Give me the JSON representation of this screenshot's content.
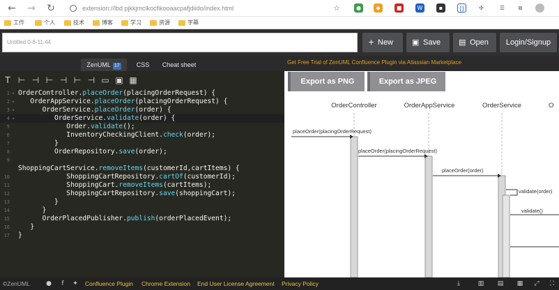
{
  "browser": {
    "url": "extension://lbd pjkkjmclkocfikooaacpafjdiido/index.html",
    "bookmarks": [
      "工作",
      "个人",
      "技术",
      "博客",
      "学习",
      "资源",
      "字幕"
    ]
  },
  "toolbar": {
    "title_value": "Untitled 0-8-11:44",
    "new_label": "New",
    "save_label": "Save",
    "open_label": "Open",
    "login_label": "Login/Signup"
  },
  "tabs": {
    "zenuml": "ZenUML",
    "zenuml_badge": "17",
    "css": "CSS",
    "cheat": "Cheat sheet"
  },
  "code": [
    {
      "n": "1",
      "f": "▾",
      "text": "OrderController.placeOrder(placingOrderRequest) {"
    },
    {
      "n": "2",
      "f": "▾",
      "text": "   OrderAppService.placeOrder(placingOrderRequest) {"
    },
    {
      "n": "3",
      "f": "▾",
      "text": "      OrderService.placeOrder(order) {"
    },
    {
      "n": "4",
      "f": "▾",
      "text": "         OrderService.validate(order) {"
    },
    {
      "n": "5",
      "f": "",
      "text": "            Order.validate();"
    },
    {
      "n": "6",
      "f": "",
      "text": "            InventoryCheckingClient.check(order);"
    },
    {
      "n": "7",
      "f": "",
      "text": "         }"
    },
    {
      "n": "8",
      "f": "",
      "text": "         OrderRepository.save(order);"
    },
    {
      "n": "9",
      "f": "",
      "text": ""
    },
    {
      "n": "",
      "f": "",
      "text": "ShoppingCartService.removeItems(customerId,cartItems) {"
    },
    {
      "n": "10",
      "f": "",
      "text": "            ShoppingCartRepository.cartOf(customerId);"
    },
    {
      "n": "11",
      "f": "",
      "text": "            ShoppingCart.removeItems(cartItems);"
    },
    {
      "n": "12",
      "f": "",
      "text": "            ShoppingCartRepository.save(shoppingCart);"
    },
    {
      "n": "13",
      "f": "",
      "text": "         }"
    },
    {
      "n": "14",
      "f": "",
      "text": "      }"
    },
    {
      "n": "15",
      "f": "",
      "text": "      OrderPlacedPublisher.publish(orderPlacedEvent);"
    },
    {
      "n": "16",
      "f": "",
      "text": "   }"
    },
    {
      "n": "17",
      "f": "",
      "text": "}"
    }
  ],
  "promo_text": "Get Free Trial of ZenUML Confluence Plugin via Atlassian Marketplace",
  "export": {
    "png": "Export as PNG",
    "jpeg": "Export as JPEG"
  },
  "diagram": {
    "participants": [
      "OrderController",
      "OrderAppService",
      "OrderService",
      "O"
    ],
    "messages": [
      "placeOrder(placingOrderRequest)",
      "placeOrder(placingOrderRequest)",
      "placeOrder(order)",
      "validate(order)",
      "validate()"
    ]
  },
  "footer": {
    "brand": "©ZenUML",
    "links": [
      "Confluence Plugin",
      "Chrome Extension",
      "End User License Agreement",
      "Privacy Policy"
    ]
  },
  "colors": {
    "accent": "#e0a020",
    "link": "#f0c040",
    "method": "#66d9ef"
  }
}
